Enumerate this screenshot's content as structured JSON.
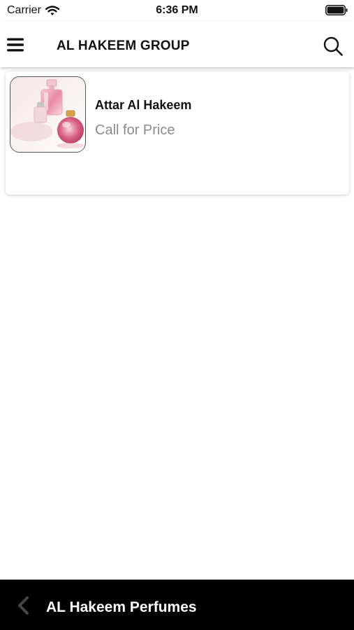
{
  "status_bar": {
    "carrier": "Carrier",
    "time": "6:36 PM"
  },
  "header": {
    "title": "AL HAKEEM GROUP"
  },
  "products": [
    {
      "name": "Attar Al Hakeem",
      "price": "Call for Price"
    }
  ],
  "footer": {
    "title": "AL Hakeem Perfumes"
  },
  "icons": {
    "menu": "hamburger-menu-icon",
    "search": "search-icon",
    "back": "back-arrow-icon",
    "wifi": "wifi-icon",
    "battery": "battery-icon"
  },
  "colors": {
    "price": "#8a8a8a",
    "footer_bg": "#000000",
    "header_bg": "#ffffff"
  }
}
